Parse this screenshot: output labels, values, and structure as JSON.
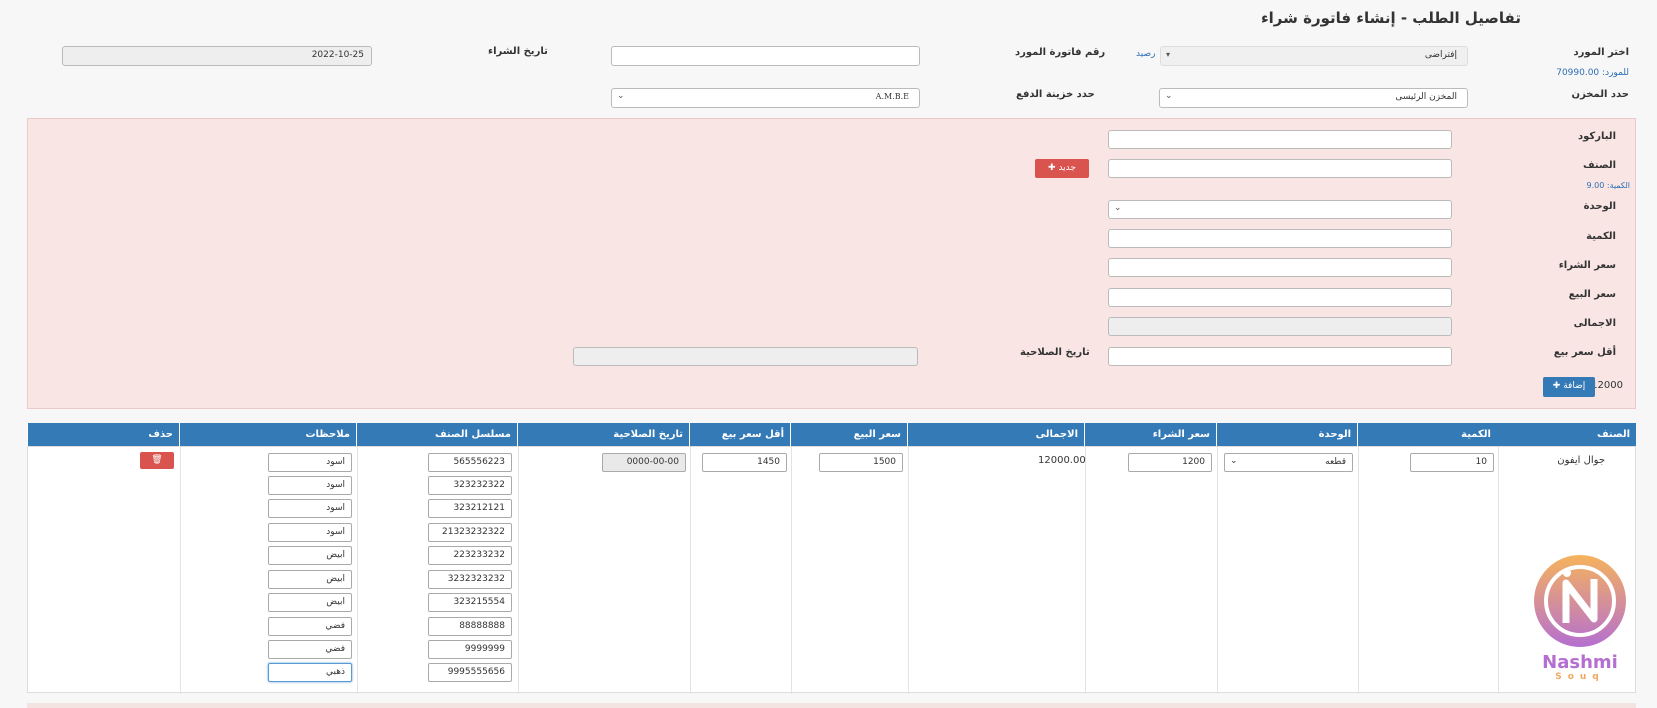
{
  "page": {
    "title": "تفاصيل الطلب - إنشاء فاتورة شراء"
  },
  "header": {
    "supplier_label": "اختر المورد",
    "supplier_value": "إفتراضى",
    "balance_link": "رصيد",
    "supplier_balance": "للمورد: 70990.00",
    "invoice_no_label": "رقم فاتورة المورد",
    "invoice_no_value": "",
    "purchase_date_label": "تاريخ الشراء",
    "purchase_date_value": "2022-10-25",
    "store_label": "حدد المخزن",
    "store_value": "المخزن الرئيسى",
    "treasury_label": "حدد خزينة الدفع",
    "treasury_value": "A.M.B.E"
  },
  "form": {
    "barcode_label": "الباركود",
    "item_label": "الصنف",
    "new_button": "جديد",
    "quantity_hint": "الكمية: 9.00",
    "unit_label": "الوحدة",
    "quantity_label": "الكمية",
    "purchase_price_label": "سعر الشراء",
    "sale_price_label": "سعر البيع",
    "total_label": "الاجمالى",
    "min_price_label": "أقل سعر بيع",
    "expiry_label": "تاريخ الصلاحية",
    "add_button": "إضافة",
    "running_total": "12000"
  },
  "table": {
    "headers": [
      "الصنف",
      "الكمية",
      "الوحدة",
      "سعر الشراء",
      "الاجمالى",
      "سعر البيع",
      "أقل سعر بيع",
      "تاريخ الصلاحية",
      "مسلسل الصنف",
      "ملاحظات",
      "حذف"
    ],
    "row": {
      "item": "جوال ايفون",
      "quantity": "10",
      "unit": "قطعه",
      "purchase_price": "1200",
      "total": "12000.00",
      "sale_price": "1500",
      "min_price": "1450",
      "expiry": "0000-00-00",
      "serials": [
        "565556223",
        "323232322",
        "323212121",
        "21323232322",
        "223233232",
        "3232323232",
        "323215554",
        "88888888",
        "9999999",
        "9995555656"
      ],
      "notes": [
        "اسود",
        "اسود",
        "اسود",
        "اسود",
        "ابيض",
        "ابيض",
        "ابيض",
        "فضي",
        "فضي",
        "ذهبي"
      ]
    }
  },
  "logo": {
    "name": "Nashmi",
    "sub": "Souq",
    "icon": "nashmi-n-logo-icon"
  },
  "colors": {
    "primary": "#337ab7",
    "danger": "#d9534f",
    "panel": "#f8e5e4"
  }
}
